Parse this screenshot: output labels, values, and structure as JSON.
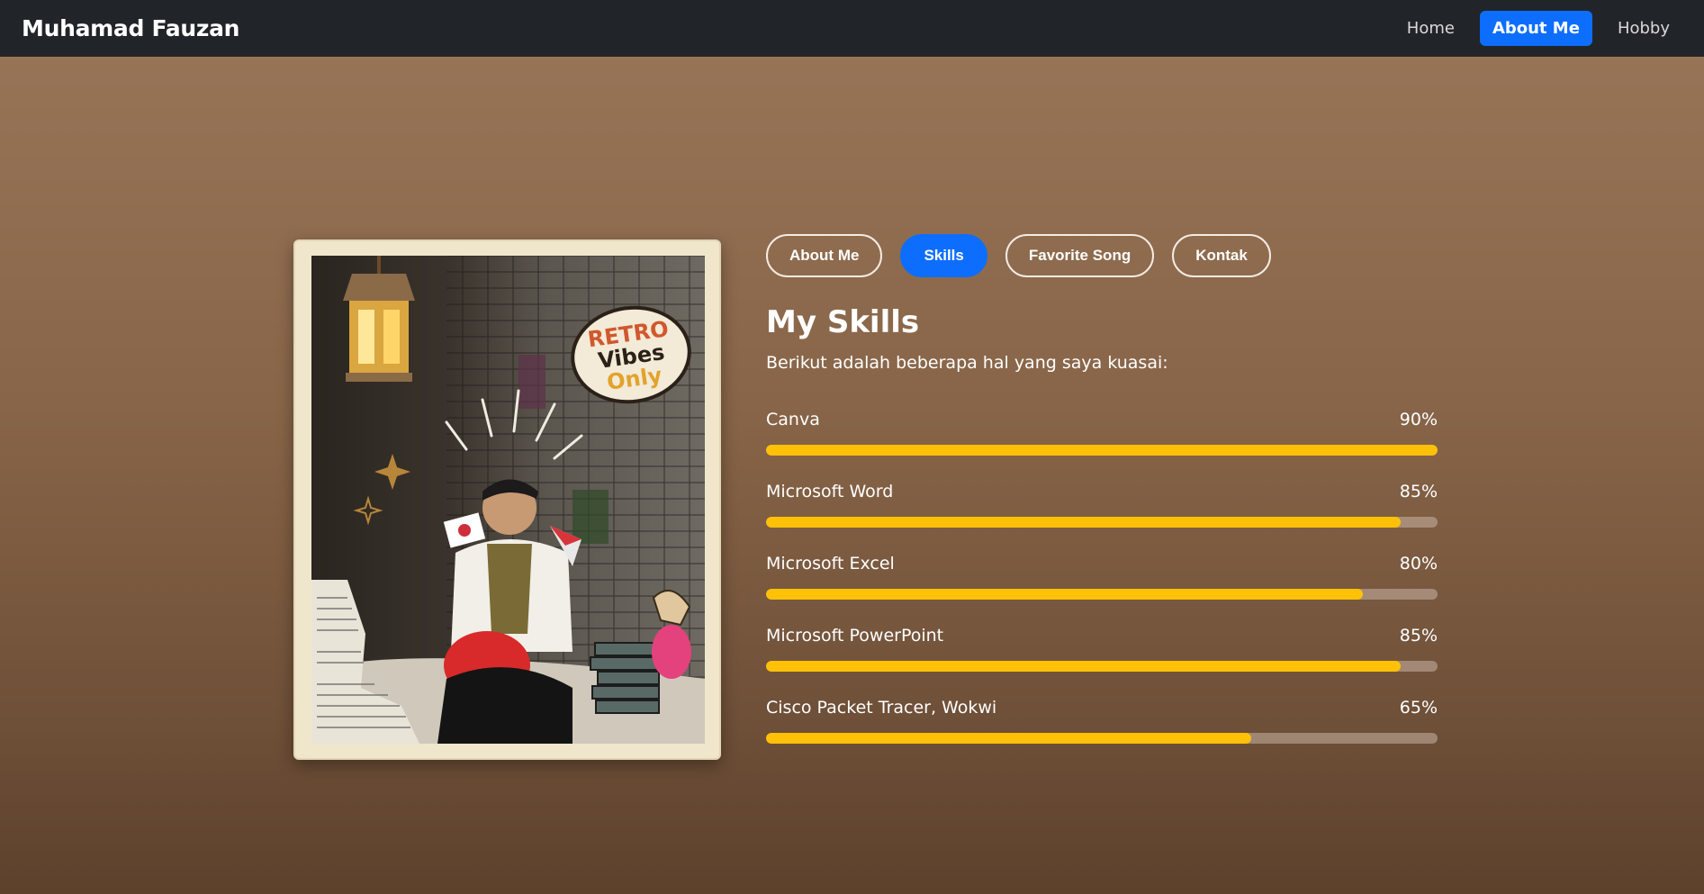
{
  "navbar": {
    "brand": "Muhamad Fauzan",
    "links": [
      {
        "label": "Home",
        "active": false
      },
      {
        "label": "About Me",
        "active": true
      },
      {
        "label": "Hobby",
        "active": false
      }
    ]
  },
  "tabs": [
    {
      "label": "About Me",
      "active": false
    },
    {
      "label": "Skills",
      "active": true
    },
    {
      "label": "Favorite Song",
      "active": false
    },
    {
      "label": "Kontak",
      "active": false
    }
  ],
  "section": {
    "title": "My Skills",
    "subtitle": "Berikut adalah beberapa hal yang saya kuasai:"
  },
  "skills": [
    {
      "name": "Canva",
      "percent_label": "90%",
      "level": 90
    },
    {
      "name": "Microsoft Word",
      "percent_label": "85%",
      "level": 85
    },
    {
      "name": "Microsoft Excel",
      "percent_label": "80%",
      "level": 80
    },
    {
      "name": "Microsoft PowerPoint",
      "percent_label": "85%",
      "level": 85
    },
    {
      "name": "Cisco Packet Tracer, Wokwi",
      "percent_label": "65%",
      "level": 65
    }
  ],
  "colors": {
    "navbar_bg": "#212529",
    "accent": "#0d6efd",
    "progress": "#ffc107"
  },
  "photo": {
    "sticker_text": [
      "RETRO",
      "Vibes",
      "Only"
    ]
  }
}
